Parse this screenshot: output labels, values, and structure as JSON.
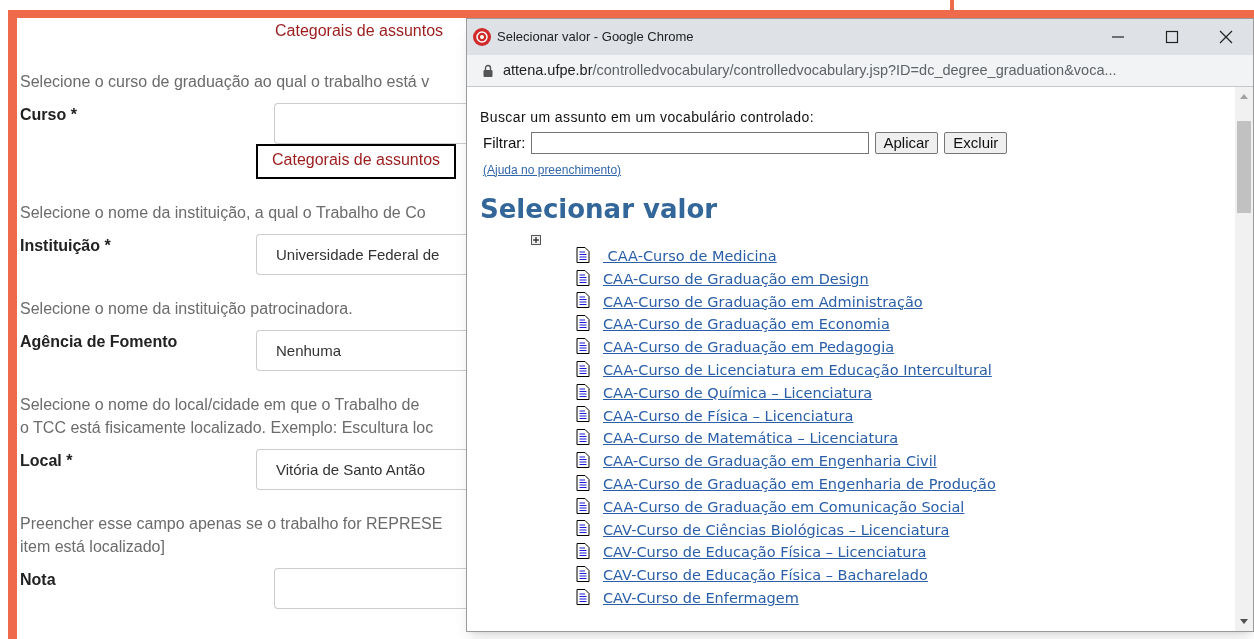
{
  "form": {
    "top_link": "Categorais de assuntos",
    "fields": [
      {
        "kind": "curso",
        "help": [
          "Selecione o curso de graduação ao qual o trabalho está v"
        ],
        "label": "Curso *",
        "link": "Categorais de assuntos"
      },
      {
        "kind": "select",
        "help": [
          "Selecione o nome da instituição, a qual o Trabalho de Co"
        ],
        "label": "Instituição *",
        "value": "Universidade Federal de"
      },
      {
        "kind": "select",
        "help": [
          "Selecione o nome da instituição patrocinadora."
        ],
        "label": "Agência de Fomento",
        "value": "Nenhuma"
      },
      {
        "kind": "select",
        "help": [
          "Selecione o nome do local/cidade em que o Trabalho de",
          "o TCC está fisicamente localizado. Exemplo: Escultura loc"
        ],
        "label": "Local *",
        "value": "Vitória de Santo Antão"
      },
      {
        "kind": "text",
        "help": [
          "Preencher esse campo apenas se o trabalho for REPRESE",
          "item está localizado]"
        ],
        "label": "Nota"
      }
    ]
  },
  "popup": {
    "title": "Selecionar valor - Google Chrome",
    "url_host": "attena.ufpe.br",
    "url_path": "/controlledvocabulary/controlledvocabulary.jsp?ID=dc_degree_graduation&voca...",
    "intro": "Buscar um assunto em um vocabulário controlado:",
    "filter_label": "Filtrar:",
    "buttons": [
      "Aplicar",
      "Excluir"
    ],
    "help_link": "(Ajuda no preenchimento)",
    "heading": "Selecionar valor",
    "tree": [
      {
        "expanded": false,
        "children": [
          {
            "label": " CAA-Curso de Medicina"
          },
          {
            "label": "CAA-Curso de Graduação em Design"
          },
          {
            "label": "CAA-Curso de Graduação em Administração"
          },
          {
            "label": "CAA-Curso de Graduação em Economia"
          },
          {
            "label": "CAA-Curso de Graduação em Pedagogia"
          },
          {
            "label": "CAA-Curso de Licenciatura em Educação Intercultural"
          },
          {
            "label": "CAA-Curso de Química – Licenciatura"
          },
          {
            "label": "CAA-Curso de Física – Licenciatura"
          },
          {
            "label": "CAA-Curso de Matemática – Licenciatura"
          },
          {
            "label": "CAA-Curso de Graduação em Engenharia Civil"
          },
          {
            "label": "CAA-Curso de Graduação em Engenharia de Produção"
          },
          {
            "label": "CAA-Curso de Graduação em Comunicação Social"
          },
          {
            "label": "CAV-Curso de Ciências Biológicas – Licenciatura"
          },
          {
            "label": "CAV-Curso de Educação Física – Licenciatura"
          },
          {
            "label": "CAV-Curso de Educação Física – Bacharelado"
          },
          {
            "label": "CAV-Curso de Enfermagem"
          }
        ]
      }
    ]
  }
}
